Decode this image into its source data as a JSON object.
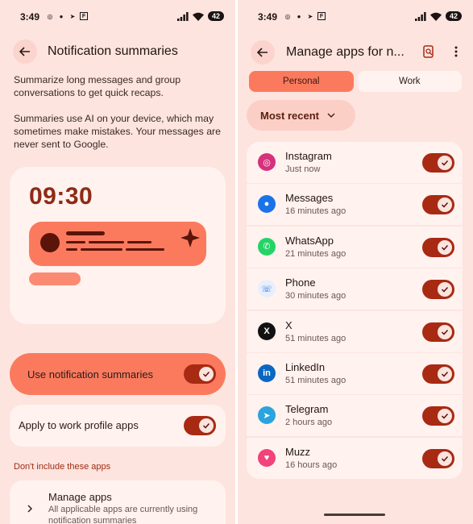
{
  "status": {
    "time": "3:49",
    "battery": "42"
  },
  "left": {
    "title": "Notification summaries",
    "desc1": "Summarize long messages and group conversations to get quick recaps.",
    "desc2": "Summaries use AI on your device, which may sometimes make mistakes. Your messages are never sent to Google.",
    "preview_clock": "09:30",
    "use_label": "Use notification summaries",
    "use_on": true,
    "work_label": "Apply to work profile apps",
    "work_on": true,
    "section": "Don't include these apps",
    "manage_title": "Manage apps",
    "manage_sub": "All applicable apps are currently using notification summaries"
  },
  "right": {
    "title": "Manage apps for n...",
    "tabs": {
      "personal": "Personal",
      "work": "Work"
    },
    "sort": "Most recent",
    "apps": [
      {
        "name": "Instagram",
        "time": "Just now",
        "color": "#d6317c",
        "glyph": "◎"
      },
      {
        "name": "Messages",
        "time": "16 minutes ago",
        "color": "#1a73e8",
        "glyph": "●"
      },
      {
        "name": "WhatsApp",
        "time": "21 minutes ago",
        "color": "#25d366",
        "glyph": "✆"
      },
      {
        "name": "Phone",
        "time": "30 minutes ago",
        "color": "#e8eefc",
        "glyph": "☏"
      },
      {
        "name": "X",
        "time": "51 minutes ago",
        "color": "#111111",
        "glyph": "X"
      },
      {
        "name": "LinkedIn",
        "time": "51 minutes ago",
        "color": "#0a66c2",
        "glyph": "in"
      },
      {
        "name": "Telegram",
        "time": "2 hours ago",
        "color": "#2aa3df",
        "glyph": "➤"
      },
      {
        "name": "Muzz",
        "time": "16 hours ago",
        "color": "#f2427a",
        "glyph": "♥"
      }
    ]
  }
}
